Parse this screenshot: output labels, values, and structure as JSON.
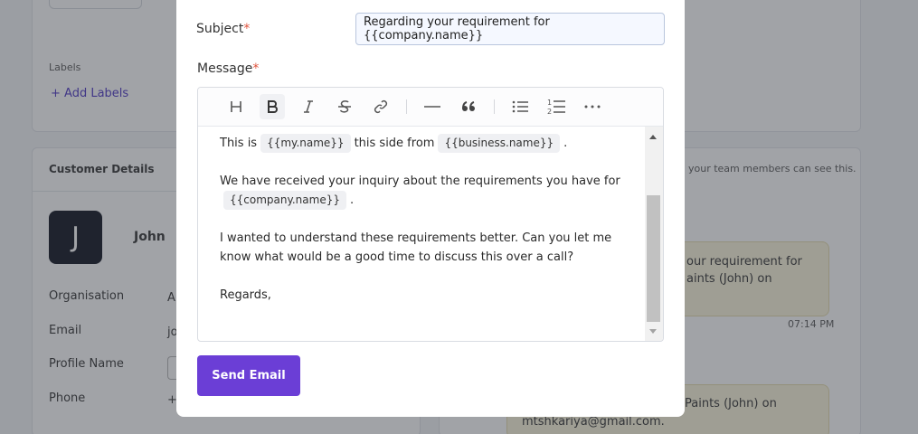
{
  "background": {
    "labels_heading": "Labels",
    "add_labels": "Add Labels",
    "customer_details_title": "Customer Details",
    "team_note": "your team members can see this.",
    "avatar_letter": "J",
    "customer_name": "John",
    "fields": [
      "Organisation",
      "Email",
      "Profile Name",
      "Phone"
    ],
    "field_values_partial": [
      "A",
      "jo",
      "",
      "+"
    ],
    "bubble1_lines": [
      "our requirement for",
      "aints (John) on"
    ],
    "bubble1_time": "07:14 PM",
    "bubble2_lines": [
      "Paints (John) on",
      "mtshkariya@gmail.com."
    ]
  },
  "modal": {
    "subject_label": "Subject",
    "subject_value": "Regarding your requirement for {{company.name}}",
    "message_label": "Message",
    "required_mark": "*",
    "editor": {
      "body": {
        "l1_pre": "This is",
        "l1_chip1": "{{my.name}}",
        "l1_mid": "this side from",
        "l1_chip2": "{{business.name}}",
        "l1_post": ".",
        "p2_line1": "We have received your inquiry about the requirements you have for",
        "p2_chip": "{{company.name}}",
        "p2_post": ".",
        "p3_line1": "I wanted to understand these requirements better. Can you let me",
        "p3_line2": "know what would be a good time to discuss this over a call?",
        "p4": "Regards,"
      }
    },
    "send_button": "Send Email"
  }
}
